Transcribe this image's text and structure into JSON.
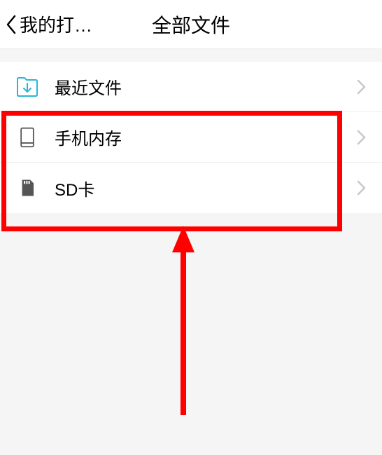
{
  "header": {
    "back_label": "我的打…",
    "title": "全部文件"
  },
  "list": {
    "items": [
      {
        "label": "最近文件"
      },
      {
        "label": "手机内存"
      },
      {
        "label": "SD卡"
      }
    ]
  }
}
